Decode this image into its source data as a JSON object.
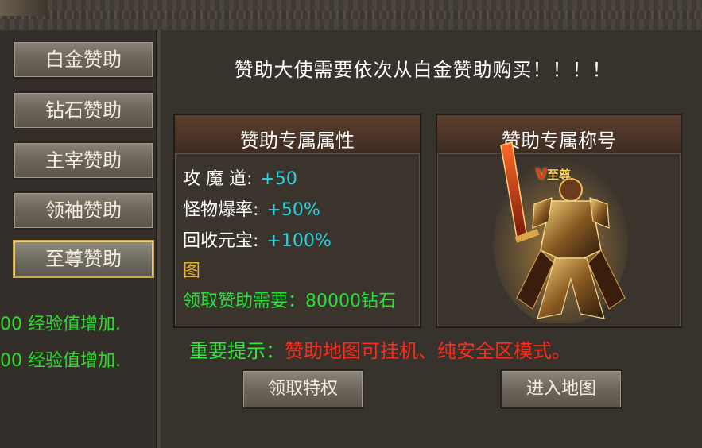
{
  "sidebar": {
    "items": [
      {
        "label": "白金赞助"
      },
      {
        "label": "钻石赞助"
      },
      {
        "label": "主宰赞助"
      },
      {
        "label": "领袖赞助"
      },
      {
        "label": "至尊赞助",
        "active": true
      }
    ],
    "exp_lines": [
      "00 经验值增加.",
      "00 经验值增加."
    ]
  },
  "main": {
    "headline": "赞助大使需要依次从白金赞助购买！！！！",
    "attributes_panel": {
      "title": "赞助专属属性",
      "rows": [
        {
          "label": "攻 魔 道:",
          "value": "+50"
        },
        {
          "label": "怪物爆率:",
          "value": "+50%"
        },
        {
          "label": "回收元宝:",
          "value": "+100%"
        }
      ],
      "extra": "图",
      "requirement": "领取赞助需要：80000钻石"
    },
    "title_panel": {
      "title": "赞助专属称号",
      "badge_text": "至尊"
    },
    "tip": {
      "label": "重要提示：",
      "text": "赞助地图可挂机、纯安全区模式。"
    },
    "buttons": {
      "claim": "领取特权",
      "enter_map": "进入地图"
    }
  },
  "colors": {
    "cyan_value": "#27d3e0",
    "green_text": "#29e03a",
    "red_text": "#ff2a1a",
    "gold_text": "#e6b030"
  }
}
